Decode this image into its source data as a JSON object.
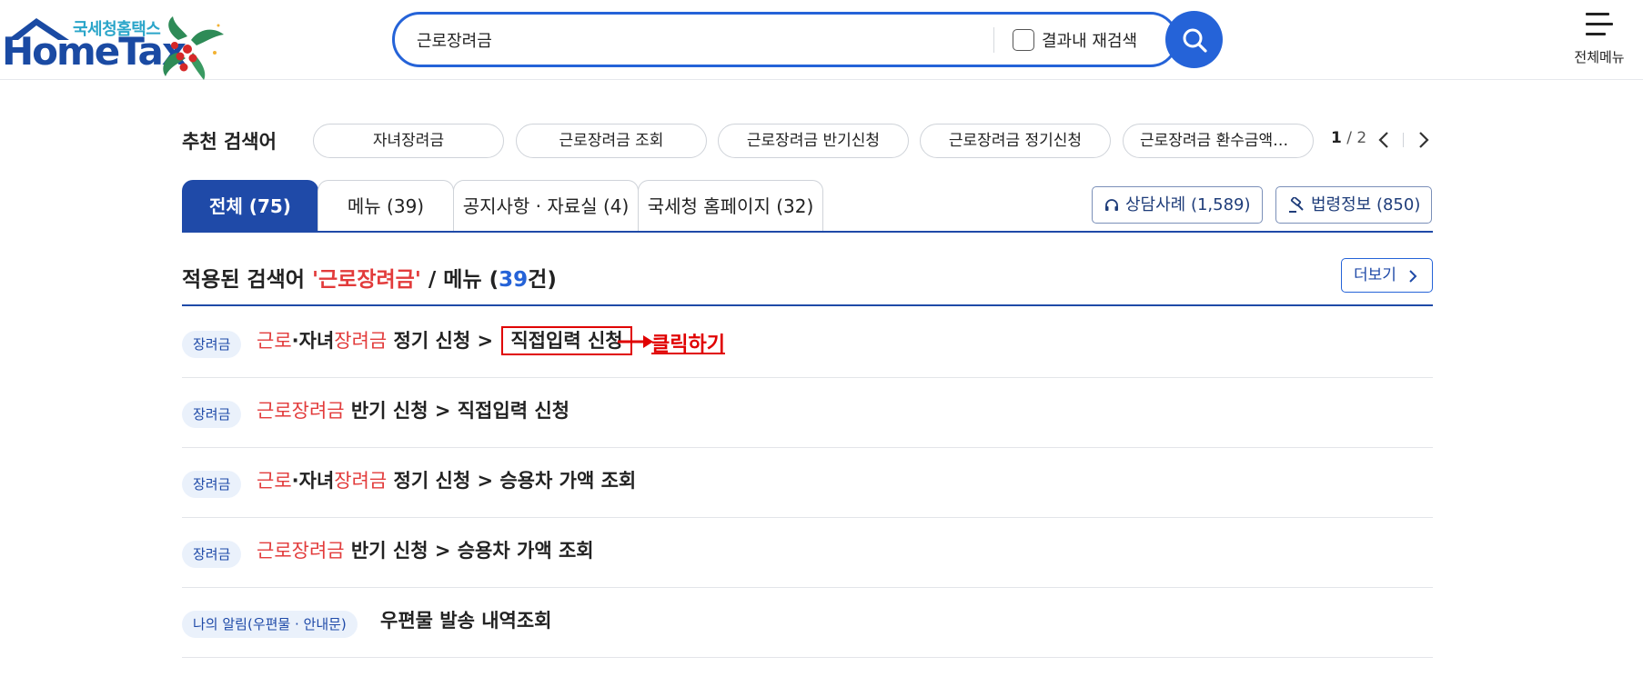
{
  "header": {
    "logo": {
      "org_name": "국세청홈택스",
      "wordmark": "HomeTax"
    },
    "search": {
      "value": "근로장려금",
      "research_label": "결과내 재검색",
      "research_checked": false
    },
    "all_menu_label": "전체메뉴"
  },
  "recommended": {
    "title": "추천 검색어",
    "chips": [
      "자녀장려금",
      "근로장려금 조회",
      "근로장려금 반기신청",
      "근로장려금 정기신청",
      "근로장려금 환수금액조회"
    ],
    "pager": {
      "current": "1",
      "separator": "/",
      "total": "2"
    }
  },
  "tabs": [
    {
      "label": "전체 (75)",
      "active": true
    },
    {
      "label": "메뉴 (39)",
      "active": false
    },
    {
      "label": "공지사항 · 자료실 (4)",
      "active": false
    },
    {
      "label": "국세청 홈페이지 (32)",
      "active": false
    }
  ],
  "external_buttons": {
    "consult": "상담사례 (1,589)",
    "law": "법령정보 (850)"
  },
  "result_header": {
    "prefix": "적용된 검색어 ",
    "keyword": "'근로장려금'",
    "middle": " / 메뉴 (",
    "count": "39",
    "suffix": "건)",
    "more_label": "더보기"
  },
  "results": [
    {
      "badge": "장려금",
      "parts": [
        [
          "근로",
          true
        ],
        [
          "·자녀",
          false
        ],
        [
          "장려금",
          true
        ],
        [
          " 정기 신청 > ",
          false
        ]
      ],
      "target": "직접입력 신청"
    },
    {
      "badge": "장려금",
      "parts": [
        [
          "근로장려금",
          true
        ],
        [
          " 반기 신청 > 직접입력 신청",
          false
        ]
      ],
      "target": ""
    },
    {
      "badge": "장려금",
      "parts": [
        [
          "근로",
          true
        ],
        [
          "·자녀",
          false
        ],
        [
          "장려금",
          true
        ],
        [
          " 정기 신청 > 승용차 가액 조회",
          false
        ]
      ],
      "target": ""
    },
    {
      "badge": "장려금",
      "parts": [
        [
          "근로장려금",
          true
        ],
        [
          " 반기 신청 > 승용차 가액 조회",
          false
        ]
      ],
      "target": ""
    },
    {
      "badge": "나의 알림(우편물 · 안내문)",
      "parts": [
        [
          "우편물 발송 내역조회",
          false
        ]
      ],
      "target": ""
    }
  ],
  "annotation": {
    "label": "클릭하기",
    "color": "#e00000"
  },
  "colors": {
    "primary": "#1f4aa8",
    "accent_blue": "#2563d8",
    "highlight_red": "#e23b3b",
    "badge_bg": "#eaf1fb"
  }
}
